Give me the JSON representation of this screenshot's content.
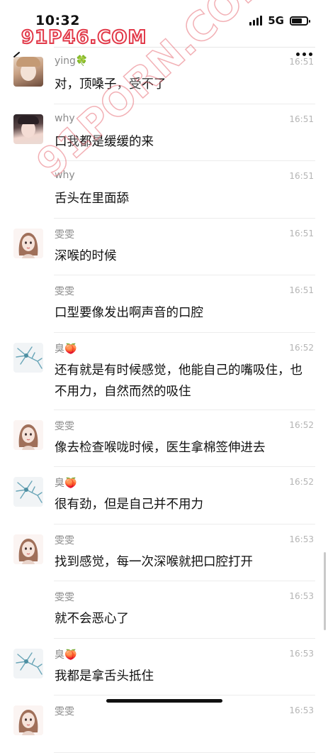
{
  "status": {
    "time": "10:32",
    "network": "5G",
    "battery_level": 0.7
  },
  "watermark": {
    "top": "91P46.COM",
    "diagonal": "91PORN.COM"
  },
  "icons": {
    "back": "back-chevron-icon",
    "more": "more-dots-icon"
  },
  "messages": [
    {
      "name": "ying🍀",
      "time": "16:51",
      "text": "对，顶嗓子，受不了",
      "avatar": "girl-photo-avatar"
    },
    {
      "name": "why",
      "time": "16:51",
      "text": "口我都是缓缓的来",
      "avatar": "girl-photo-avatar-2"
    },
    {
      "name": "why",
      "time": "16:51",
      "text": "舌头在里面舔",
      "avatar": ""
    },
    {
      "name": "雯雯",
      "time": "16:51",
      "text": "深喉的时候",
      "avatar": "cartoon-girl-avatar"
    },
    {
      "name": "雯雯",
      "time": "16:51",
      "text": "口型要像发出啊声音的口腔",
      "avatar": ""
    },
    {
      "name": "臭🍑",
      "time": "16:52",
      "text": "还有就是有时候感觉，他能自己的嘴吸住，也不用力，自然而然的吸住",
      "avatar": "neuron-avatar"
    },
    {
      "name": "雯雯",
      "time": "16:52",
      "text": "像去检查喉咙时候，医生拿棉签伸进去",
      "avatar": "cartoon-girl-avatar"
    },
    {
      "name": "臭🍑",
      "time": "16:52",
      "text": "很有劲，但是自己并不用力",
      "avatar": "neuron-avatar"
    },
    {
      "name": "雯雯",
      "time": "16:53",
      "text": "找到感觉，每一次深喉就把口腔打开",
      "avatar": "cartoon-girl-avatar"
    },
    {
      "name": "雯雯",
      "time": "16:53",
      "text": "就不会恶心了",
      "avatar": ""
    },
    {
      "name": "臭🍑",
      "time": "16:53",
      "text": "我都是拿舌头抵住",
      "avatar": "neuron-avatar"
    },
    {
      "name": "雯雯",
      "time": "16:53",
      "text": "",
      "avatar": "cartoon-girl-avatar"
    }
  ]
}
